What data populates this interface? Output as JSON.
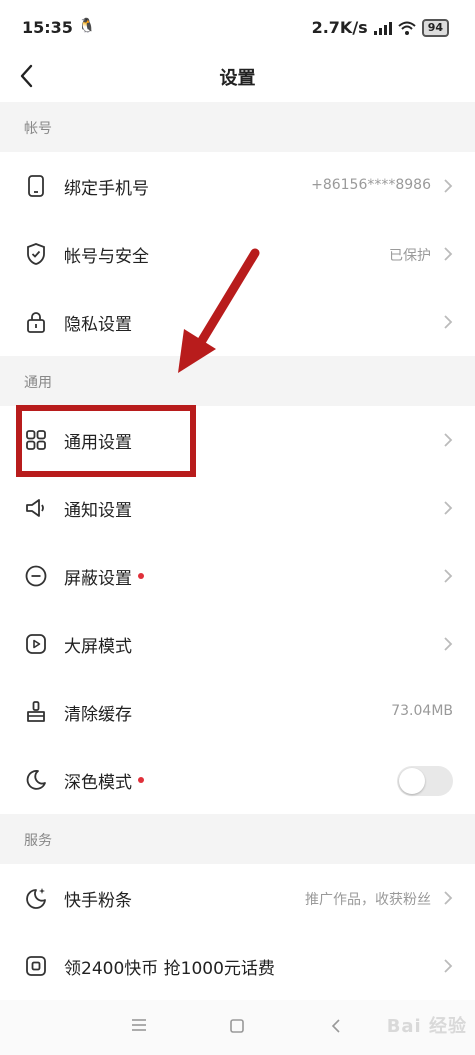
{
  "status_bar": {
    "time": "15:35",
    "network_speed": "2.7K/s",
    "battery": "94"
  },
  "header": {
    "title": "设置"
  },
  "sections": {
    "account": {
      "title": "帐号",
      "items": [
        {
          "label": "绑定手机号",
          "value": "+86156****8986",
          "icon": "phone-icon"
        },
        {
          "label": "帐号与安全",
          "value": "已保护",
          "icon": "shield-check-icon"
        },
        {
          "label": "隐私设置",
          "value": "",
          "icon": "lock-icon"
        }
      ]
    },
    "general": {
      "title": "通用",
      "items": [
        {
          "label": "通用设置",
          "icon": "grid-icon"
        },
        {
          "label": "通知设置",
          "icon": "speaker-icon"
        },
        {
          "label": "屏蔽设置",
          "icon": "minus-circle-icon",
          "badge": true
        },
        {
          "label": "大屏模式",
          "icon": "play-square-icon"
        },
        {
          "label": "清除缓存",
          "value": "73.04MB",
          "icon": "broom-icon"
        },
        {
          "label": "深色模式",
          "icon": "moon-icon",
          "badge": true,
          "toggle": false
        }
      ]
    },
    "services": {
      "title": "服务",
      "items": [
        {
          "label": "快手粉条",
          "value": "推广作品，收获粉丝",
          "icon": "sparkle-moon-icon"
        },
        {
          "label": "领2400快币 抢1000元话费",
          "icon": "coin-card-icon"
        }
      ]
    }
  },
  "watermark": "Bai 经验",
  "colors": {
    "annotation": "#b81c1c",
    "badge": "#e0303a",
    "background": "#f4f4f4"
  }
}
